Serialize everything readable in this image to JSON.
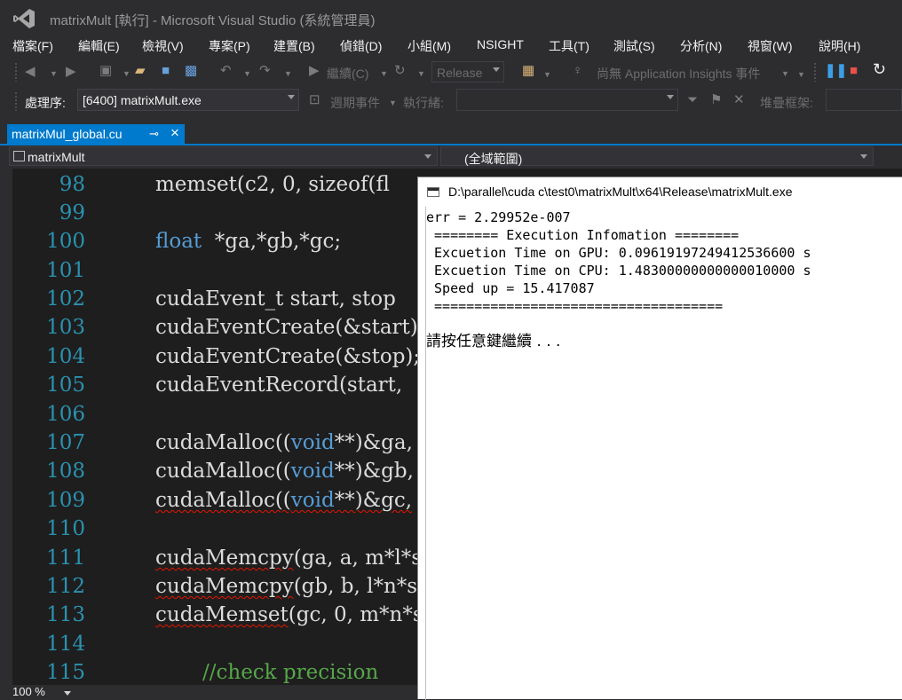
{
  "window": {
    "title": "matrixMult [執行] - Microsoft Visual Studio (系統管理員)"
  },
  "menu": [
    "檔案(F)",
    "編輯(E)",
    "檢視(V)",
    "專案(P)",
    "建置(B)",
    "偵錯(D)",
    "小組(M)",
    "NSIGHT",
    "工具(T)",
    "測試(S)",
    "分析(N)",
    "視窗(W)",
    "說明(H)"
  ],
  "toolbar": {
    "continue_label": "繼續(C)",
    "config_value": "Release",
    "insights_label": "尚無 Application Insights 事件"
  },
  "debug_toolbar": {
    "process_label": "處理序:",
    "process_value": "[6400] matrixMult.exe",
    "lifecycle_label": "週期事件",
    "thread_label": "執行緒:",
    "thread_value": "",
    "stack_label": "堆疊框架:"
  },
  "doc_tab": {
    "name": "matrixMul_global.cu"
  },
  "navbar": {
    "project": "matrixMult",
    "scope": "(全域範圍)"
  },
  "editor": {
    "line_numbers": [
      "98",
      "99",
      "100",
      "101",
      "102",
      "103",
      "104",
      "105",
      "106",
      "107",
      "108",
      "109",
      "110",
      "111",
      "112",
      "113",
      "114",
      "115"
    ],
    "code": {
      "l98": "memset(c2, 0, sizeof(fl",
      "l100_kw": "float",
      "l100_rest": "  *ga,*gb,*gc;",
      "l102": "cudaEvent_t start, stop",
      "l103": "cudaEventCreate(&start)",
      "l104": "cudaEventCreate(&stop);",
      "l105": "cudaEventRecord(start, ",
      "l107_a": "cudaMalloc((",
      "l107_kw": "void",
      "l107_b": "**)&ga,",
      "l108_a": "cudaMalloc((",
      "l108_kw": "void",
      "l108_b": "**)&gb,",
      "l109_a": "cudaMalloc((",
      "l109_kw": "void",
      "l109_b": "**)&gc,",
      "l111_a": "cudaMemcpy",
      "l111_b": "(ga, a, m*l*s",
      "l112_a": "cudaMemcpy",
      "l112_b": "(gb, b, l*n*s",
      "l113_a": "cudaMemset",
      "l113_b": "(gc, 0, m*n*s",
      "l115": "//check precision"
    }
  },
  "status": {
    "zoom": "100 %"
  },
  "console": {
    "title": "D:\\parallel\\cuda c\\test0\\matrixMult\\x64\\Release\\matrixMult.exe",
    "lines": [
      "err = 2.29952e-007",
      " ======== Execution Infomation ========",
      " Excuetion Time on GPU: 0.09619197249412536600 s",
      " Excuetion Time on CPU: 1.48300000000000010000 s",
      " Speed up = 15.417087",
      " ===================================="
    ],
    "prompt": "請按任意鍵繼續 . . ."
  }
}
